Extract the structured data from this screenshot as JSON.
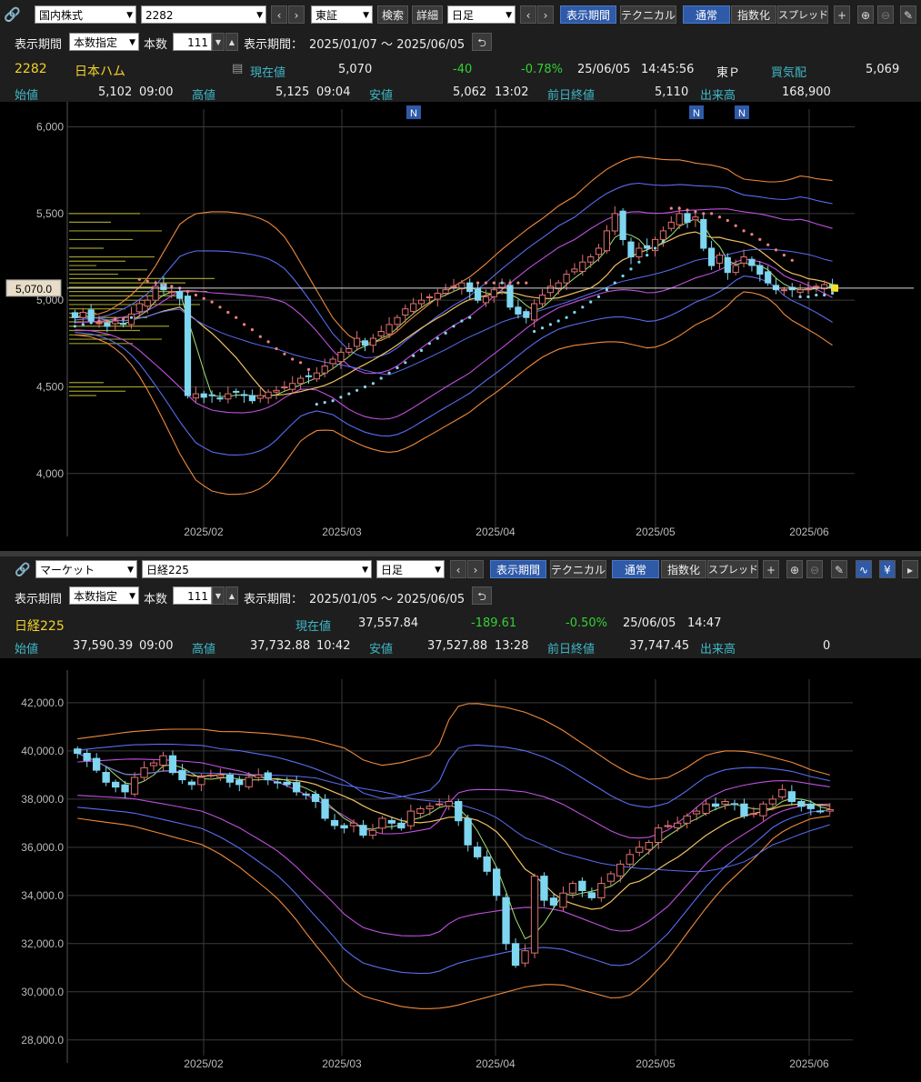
{
  "top": {
    "toolbar": {
      "market_select": "国内株式",
      "code_input": "2282",
      "exchange_select": "東証",
      "search_button": "検索",
      "detail_button": "詳細",
      "period_select": "日足",
      "display_period_button": "表示期間",
      "technical_button": "テクニカル",
      "normal_button": "通常",
      "index_button": "指数化",
      "spread_button": "スプレッド"
    },
    "period_row": {
      "label": "表示期間",
      "mode_select": "本数指定",
      "count_label": "本数",
      "count_value": "111",
      "range_label": "表示期間：",
      "range_value": "2025/01/07 ～ 2025/06/05"
    },
    "quote": {
      "code": "2282",
      "name": "日本ハム",
      "current_label": "現在値",
      "current": "5,070",
      "change": "-40",
      "change_pct": "-0.78%",
      "date": "25/06/05",
      "time": "14:45:56",
      "market": "東Ｐ",
      "bid_label": "買気配",
      "bid": "5,069",
      "open_label": "始値",
      "open": "5,102",
      "open_time": "09:00",
      "high_label": "高値",
      "high": "5,125",
      "high_time": "09:04",
      "low_label": "安値",
      "low": "5,062",
      "low_time": "13:02",
      "prev_label": "前日終値",
      "prev": "5,110",
      "volume_label": "出来高",
      "volume": "168,900"
    },
    "price_marker": "5,070.0",
    "news_marker": "N"
  },
  "bottom": {
    "toolbar": {
      "market_select": "マーケット",
      "index_select": "日経225",
      "period_select": "日足",
      "display_period_button": "表示期間",
      "technical_button": "テクニカル",
      "normal_button": "通常",
      "index_button": "指数化",
      "spread_button": "スプレッド"
    },
    "period_row": {
      "label": "表示期間",
      "mode_select": "本数指定",
      "count_label": "本数",
      "count_value": "111",
      "range_label": "表示期間：",
      "range_value": "2025/01/05 ～ 2025/06/05"
    },
    "quote": {
      "name": "日経225",
      "current_label": "現在値",
      "current": "37,557.84",
      "change": "-189.61",
      "change_pct": "-0.50%",
      "date": "25/06/05",
      "time": "14:47",
      "open_label": "始値",
      "open": "37,590.39",
      "open_time": "09:00",
      "high_label": "高値",
      "high": "37,732.88",
      "high_time": "10:42",
      "low_label": "安値",
      "low": "37,527.88",
      "low_time": "13:28",
      "prev_label": "前日終値",
      "prev": "37,747.45",
      "volume_label": "出来高",
      "volume": "0"
    }
  },
  "colors": {
    "up_candle": "#e07070",
    "down_candle": "#7fd6f0",
    "sar_up": "#f08080",
    "sar_down": "#7fd6f0",
    "bb_outer": "#f08a3c",
    "bb_mid": "#5a6cf0",
    "bb_inner": "#c050e0",
    "ma_short": "#a0e070",
    "ma_long": "#f0c060",
    "volume_profile": "#9a9a2a",
    "grid": "#3a3a3a"
  },
  "chart_data": [
    {
      "type": "candlestick",
      "title": "日本ハム",
      "x_ticks": [
        "2025/02",
        "2025/03",
        "2025/04",
        "2025/05",
        "2025/06"
      ],
      "y_ticks": [
        "4,000",
        "4,500",
        "5,000",
        "5,500",
        "6,000"
      ],
      "ylim": [
        3700,
        6050
      ],
      "grid": true,
      "close": [
        4900,
        4930,
        4880,
        4870,
        4850,
        4880,
        4860,
        4920,
        4980,
        5000,
        5080,
        5060,
        5050,
        5010,
        4450,
        4460,
        4440,
        4450,
        4430,
        4460,
        4470,
        4450,
        4420,
        4450,
        4470,
        4480,
        4500,
        4520,
        4550,
        4560,
        4580,
        4620,
        4660,
        4700,
        4720,
        4780,
        4740,
        4780,
        4820,
        4860,
        4900,
        4950,
        4980,
        5000,
        5020,
        5040,
        5060,
        5080,
        5100,
        5050,
        5000,
        5020,
        5060,
        5100,
        4960,
        4920,
        4900,
        4980,
        5030,
        5080,
        5100,
        5150,
        5180,
        5220,
        5250,
        5300,
        5400,
        5500,
        5350,
        5250,
        5300,
        5300,
        5350,
        5400,
        5450,
        5500,
        5450,
        5480,
        5300,
        5200,
        5260,
        5160,
        5200,
        5250,
        5200,
        5150,
        5100,
        5060,
        5060,
        5060,
        5060,
        5065,
        5080,
        5090,
        5070
      ],
      "sar": [
        4850,
        4860,
        4870,
        4880,
        4880,
        4890,
        4890,
        4900,
        5120,
        5110,
        5100,
        5090,
        5080,
        5070,
        5050,
        5030,
        5010,
        4990,
        4960,
        4930,
        4900,
        4860,
        4830,
        4790,
        4760,
        4720,
        4690,
        4660,
        4640,
        4600,
        4400,
        4410,
        4420,
        4440,
        4460,
        4480,
        4500,
        4520,
        4550,
        4580,
        4610,
        4640,
        4680,
        4710,
        4750,
        4780,
        4810,
        4850,
        4880,
        4900,
        5100,
        5100,
        5100,
        5100,
        5100,
        5100,
        5100,
        4820,
        4840,
        4860,
        4880,
        4900,
        4930,
        4960,
        4990,
        5020,
        5060,
        5100,
        5140,
        5180,
        5220,
        5260,
        5300,
        5340,
        5530,
        5530,
        5520,
        5510,
        5500,
        5500,
        5480,
        5460,
        5430,
        5400,
        5380,
        5350,
        5320,
        5290,
        5260,
        5230,
        5020,
        5020,
        5030,
        5030,
        5040
      ],
      "bb_upper2": [
        4900,
        4910,
        4930,
        4980,
        5050,
        5150,
        5300,
        5450,
        5500,
        5510,
        5510,
        5500,
        5480,
        5440,
        5350,
        5200,
        5050,
        4900,
        4800,
        4750,
        4760,
        4800,
        4880,
        4950,
        5020,
        5080,
        5130,
        5200,
        5280,
        5350,
        5420,
        5480,
        5550,
        5600,
        5680,
        5750,
        5800,
        5830,
        5820,
        5810,
        5810,
        5790,
        5780,
        5760,
        5700,
        5690,
        5680,
        5690,
        5720,
        5700,
        5690
      ],
      "bb_lower2": [
        4800,
        4790,
        4760,
        4700,
        4600,
        4450,
        4280,
        4100,
        3960,
        3900,
        3880,
        3880,
        3900,
        3960,
        4080,
        4200,
        4250,
        4250,
        4200,
        4160,
        4130,
        4120,
        4150,
        4200,
        4250,
        4300,
        4350,
        4420,
        4480,
        4550,
        4620,
        4680,
        4720,
        4740,
        4750,
        4760,
        4760,
        4740,
        4720,
        4750,
        4800,
        4860,
        4900,
        4960,
        5050,
        5040,
        5000,
        4900,
        4850,
        4800,
        4740
      ],
      "volume_profile": [
        4450,
        4475,
        4500,
        4525,
        4750,
        4775,
        4800,
        4825,
        4850,
        4875,
        4900,
        4925,
        4950,
        4975,
        5000,
        5025,
        5050,
        5075,
        5100,
        5125,
        5150,
        5175,
        5200,
        5225,
        5250,
        5300,
        5350,
        5400,
        5450,
        5500
      ]
    },
    {
      "type": "candlestick",
      "title": "日経225",
      "x_ticks": [
        "2025/02",
        "2025/03",
        "2025/04",
        "2025/05",
        "2025/06"
      ],
      "y_ticks": [
        "28,000.0",
        "30,000.0",
        "32,000.0",
        "34,000.0",
        "36,000.0",
        "38,000.0",
        "40,000.0",
        "42,000.0"
      ],
      "ylim": [
        27500,
        42600
      ],
      "grid": true,
      "close": [
        39900,
        39600,
        39200,
        38700,
        38500,
        38300,
        38900,
        39300,
        39500,
        39800,
        39100,
        38800,
        38600,
        38900,
        39000,
        39000,
        38700,
        38600,
        38900,
        39000,
        38800,
        38700,
        38600,
        38300,
        38200,
        37900,
        37200,
        36900,
        36800,
        37000,
        36500,
        36700,
        37200,
        37000,
        36800,
        37500,
        37600,
        37700,
        37800,
        37900,
        37100,
        36100,
        35600,
        35000,
        34000,
        32000,
        31100,
        31700,
        34800,
        33800,
        33600,
        34100,
        34500,
        34200,
        33900,
        34500,
        34900,
        35300,
        35700,
        36000,
        36200,
        36800,
        36900,
        37000,
        37300,
        37500,
        37800,
        37700,
        37900,
        37800,
        37300,
        37400,
        37800,
        38000,
        38400,
        37900,
        37700,
        37600,
        37500,
        37560
      ],
      "bb_upper2": [
        40500,
        40600,
        40700,
        40800,
        40850,
        40900,
        40900,
        40900,
        40800,
        40800,
        40750,
        40700,
        40600,
        40500,
        40300,
        40100,
        39600,
        39400,
        39500,
        39700,
        39900,
        41800,
        42000,
        41900,
        41800,
        41600,
        41300,
        40900,
        40400,
        39900,
        39400,
        39000,
        38800,
        38900,
        39300,
        39800,
        40000,
        40000,
        39900,
        39700,
        39500,
        39200,
        39000
      ],
      "bb_lower2": [
        37200,
        37100,
        37000,
        36900,
        36700,
        36500,
        36300,
        36100,
        35700,
        35200,
        34600,
        34000,
        33200,
        32200,
        31300,
        30300,
        29800,
        29600,
        29400,
        29300,
        29300,
        29400,
        29600,
        29800,
        30000,
        30200,
        30300,
        30300,
        30100,
        29900,
        29700,
        29900,
        30600,
        31400,
        32400,
        33400,
        34300,
        35000,
        35700,
        36500,
        36900,
        37200,
        37300
      ]
    }
  ]
}
